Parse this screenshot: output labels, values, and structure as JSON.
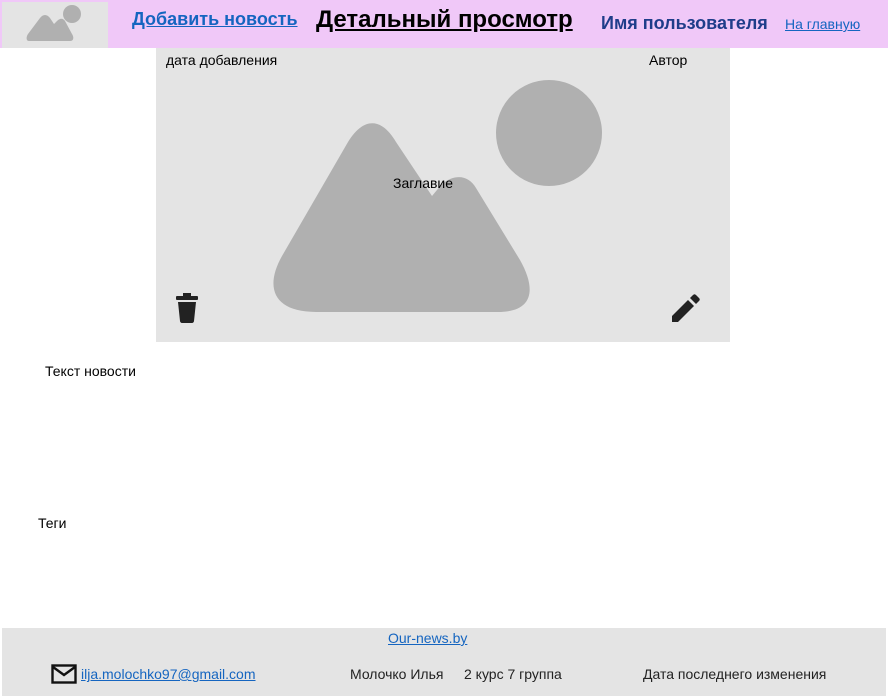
{
  "header": {
    "add_news": "Добавить новость",
    "page_title": "Детальный просмотр",
    "user_name": "Имя пользователя",
    "home_link": "На главную"
  },
  "card": {
    "date_label": "дата добавления",
    "author_label": "Автор",
    "title_label": "Заглавие",
    "image_icon": "image-placeholder-icon",
    "delete_icon": "trash-icon",
    "edit_icon": "pencil-icon"
  },
  "content": {
    "text_label": "Текст новости",
    "tags_label": "Теги"
  },
  "footer": {
    "site_link": "Our-news.by",
    "email": "ilja.molochko97@gmail.com ",
    "author": "Молочко Илья",
    "group": "2 курс 7 группа",
    "last_change": "Дата последнего изменения"
  },
  "colors": {
    "header_bg": "#f0c8f8",
    "panel_bg": "#e4e4e4",
    "placeholder": "#b0b0b0",
    "link": "#1565c0"
  }
}
